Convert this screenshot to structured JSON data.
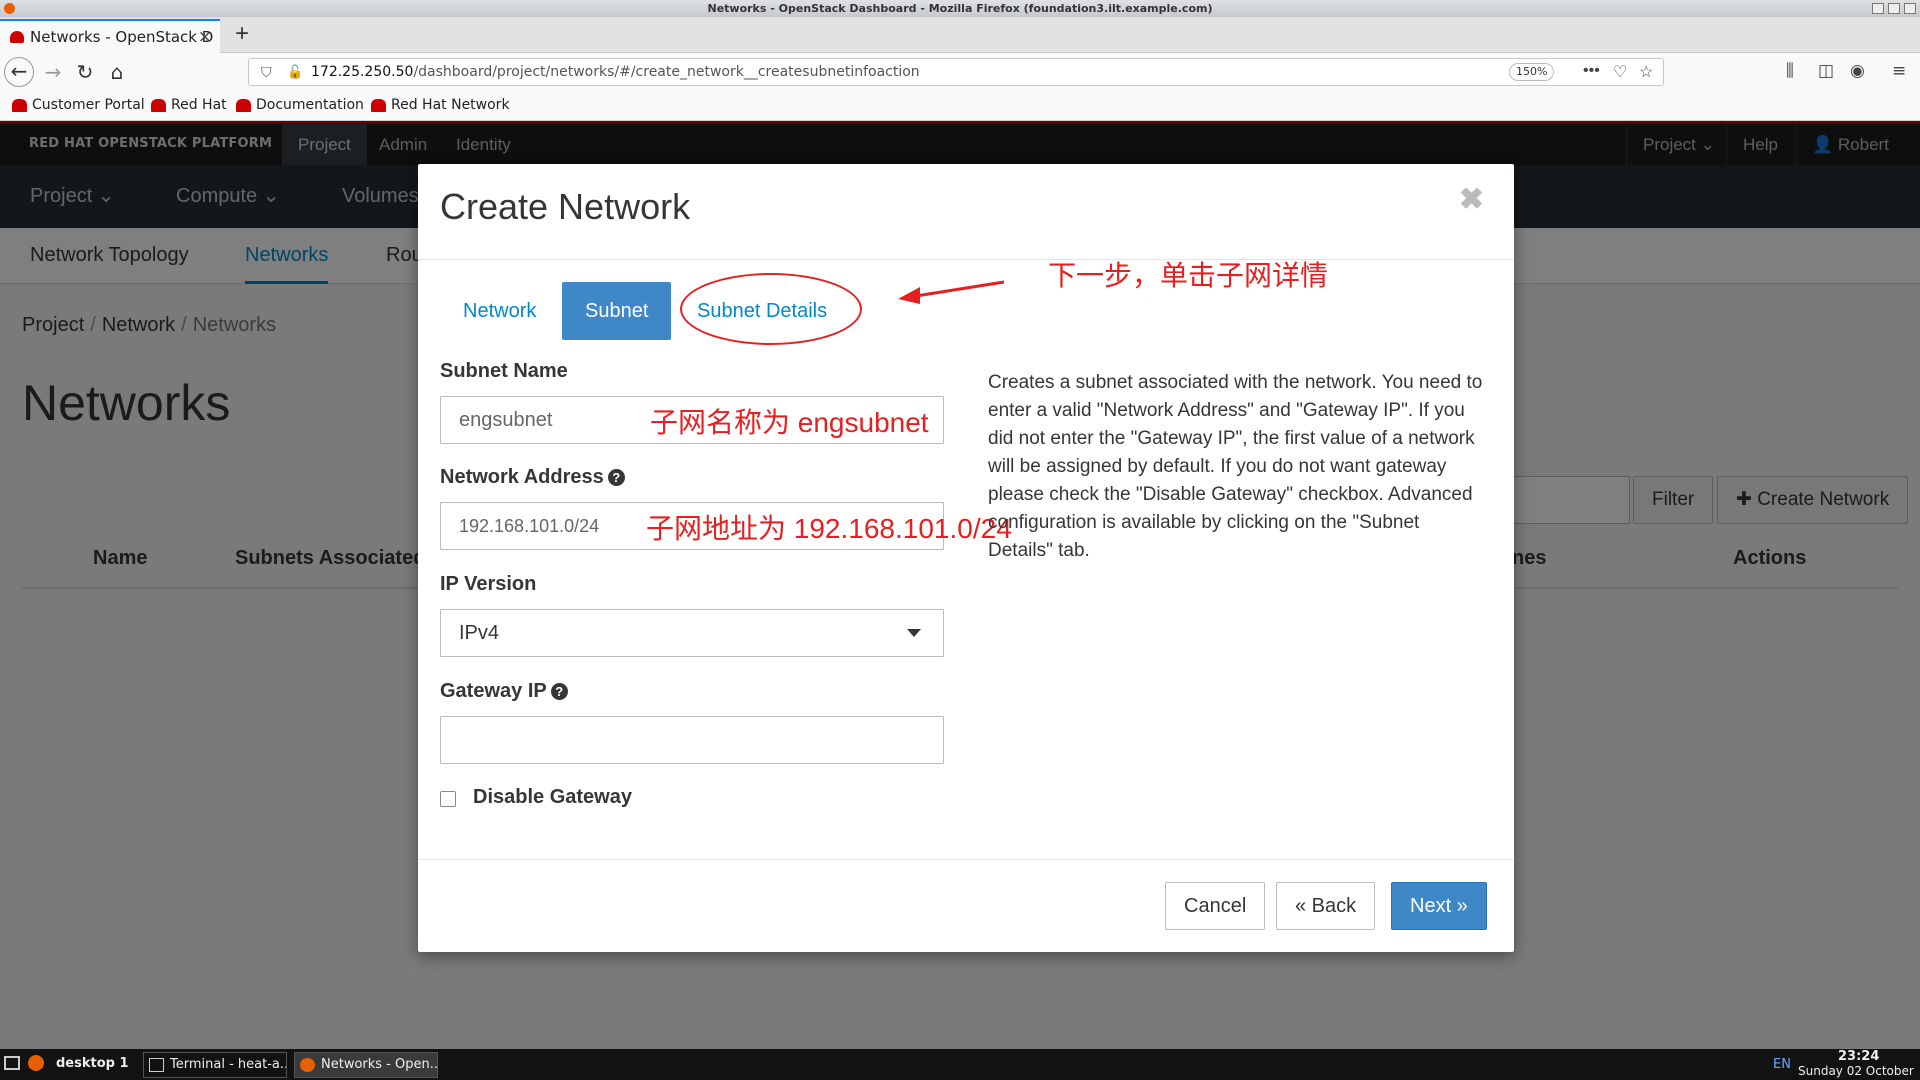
{
  "window": {
    "title": "Networks - OpenStack Dashboard - Mozilla Firefox (foundation3.ilt.example.com)"
  },
  "browser": {
    "tab_title": "Networks - OpenStack D",
    "url_host": "172.25.250.50",
    "url_path": "/dashboard/project/networks/#/create_network__createsubnetinfoaction",
    "zoom": "150%",
    "bookmarks": [
      "Customer Portal",
      "Red Hat",
      "Documentation",
      "Red Hat Network"
    ]
  },
  "masthead": {
    "brand": "RED HAT OPENSTACK PLATFORM",
    "nav": [
      "Project",
      "Admin",
      "Identity"
    ],
    "right": {
      "project": "Project ⌄",
      "help": "Help",
      "user": "Robert ⌄"
    }
  },
  "subnav": [
    "Project ⌄",
    "Compute ⌄",
    "Volumes"
  ],
  "tertnav": [
    "Network Topology",
    "Networks",
    "Rou"
  ],
  "breadcrumb": [
    "Project",
    "Network",
    "Networks"
  ],
  "page_title": "Networks",
  "toolbar": {
    "filter": "Filter",
    "create": "Create Network"
  },
  "table": {
    "headers": [
      "Name",
      "Subnets Associated",
      "nes",
      "Actions"
    ]
  },
  "modal": {
    "title": "Create Network",
    "tabs": [
      "Network",
      "Subnet",
      "Subnet Details"
    ],
    "active_tab": "Subnet",
    "fields": {
      "subnet_name": {
        "label": "Subnet Name",
        "value": "engsubnet"
      },
      "network_address": {
        "label": "Network Address",
        "value": "192.168.101.0/24"
      },
      "ip_version": {
        "label": "IP Version",
        "value": "IPv4"
      },
      "gateway_ip": {
        "label": "Gateway IP",
        "value": ""
      },
      "disable_gateway": {
        "label": "Disable Gateway",
        "checked": false
      }
    },
    "description": "Creates a subnet associated with the network. You need to enter a valid \"Network Address\" and \"Gateway IP\". If you did not enter the \"Gateway IP\", the first value of a network will be assigned by default. If you do not want gateway please check the \"Disable Gateway\" checkbox. Advanced configuration is available by clicking on the \"Subnet Details\" tab.",
    "buttons": {
      "cancel": "Cancel",
      "back": "«  Back",
      "next": "Next  »"
    }
  },
  "annotations": {
    "next_step": "下一步，单击子网详情",
    "subnet_name": "子网名称为 engsubnet",
    "network_address": "子网地址为 192.168.101.0/24"
  },
  "taskbar": {
    "workspace": "desktop 1",
    "tasks": [
      "Terminal - heat-a...",
      "Networks - Open..."
    ],
    "lang": "EN",
    "time": "23:24",
    "date": "Sunday 02 October"
  },
  "colors": {
    "accent": "#0088ce",
    "primary_button": "#3f88c8",
    "annotation": "#e62020",
    "brand_red": "#cc0000"
  }
}
